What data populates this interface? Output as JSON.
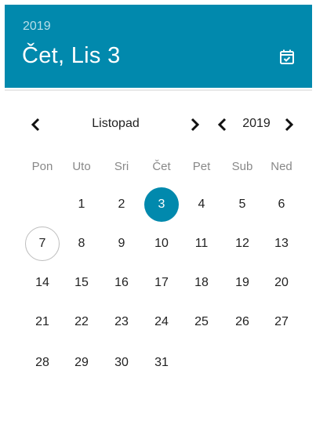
{
  "header": {
    "year": "2019",
    "date": "Čet, Lis 3",
    "calendar_icon": "calendar-check-icon"
  },
  "nav": {
    "month": "Listopad",
    "year": "2019",
    "prev_month_icon": "chevron-left-icon",
    "next_month_icon": "chevron-right-icon",
    "prev_year_icon": "chevron-left-icon",
    "next_year_icon": "chevron-right-icon"
  },
  "weekdays": [
    "Pon",
    "Uto",
    "Sri",
    "Čet",
    "Pet",
    "Sub",
    "Ned"
  ],
  "weeks": [
    [
      "",
      "1",
      "2",
      "3",
      "4",
      "5",
      "6"
    ],
    [
      "7",
      "8",
      "9",
      "10",
      "11",
      "12",
      "13"
    ],
    [
      "14",
      "15",
      "16",
      "17",
      "18",
      "19",
      "20"
    ],
    [
      "21",
      "22",
      "23",
      "24",
      "25",
      "26",
      "27"
    ],
    [
      "28",
      "29",
      "30",
      "31",
      "",
      "",
      ""
    ]
  ],
  "selected_day": "3",
  "today_day": "7",
  "colors": {
    "accent": "#0189ad",
    "header_text": "#ffffff",
    "weekday_text": "#888888",
    "today_ring": "#bdbdbd"
  }
}
